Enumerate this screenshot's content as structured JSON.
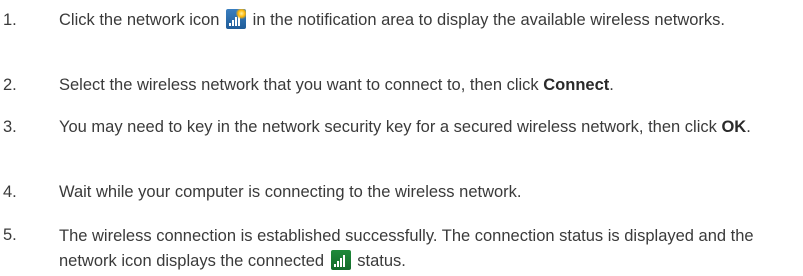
{
  "steps": [
    {
      "number": "1.",
      "before_icon": "Click the network icon",
      "icon": "network-available-icon",
      "after_icon": " in the notification area to display the available wireless networks."
    },
    {
      "number": "2.",
      "before_bold": "Select the wireless network that you want to connect to, then click ",
      "bold": "Connect",
      "after_bold": "."
    },
    {
      "number": "3.",
      "before_bold": "You may need to key in the network security key for a secured wireless network, then click ",
      "bold": "OK",
      "after_bold": "."
    },
    {
      "number": "4.",
      "text": "Wait while your computer is connecting to the wireless network."
    },
    {
      "number": "5.",
      "before_icon": "The wireless connection is established successfully. The connection status is displayed and the network icon displays the connected",
      "icon": "network-connected-icon",
      "after_icon": " status."
    }
  ],
  "colors": {
    "text": "#3a3a3a",
    "icon_network_bg": "#2a6fae",
    "icon_connected_bg": "#1a7a34",
    "icon_accent": "#ffb400"
  }
}
